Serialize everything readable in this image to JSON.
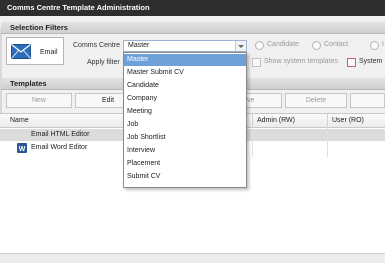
{
  "window": {
    "title": "Comms Centre Template Administration"
  },
  "selection_filters": {
    "header": "Selection Filters",
    "email_button": "Email",
    "comms_centre_label": "Comms Centre",
    "apply_filter_label": "Apply filter",
    "combo_value": "Master",
    "radios": [
      "Candidate",
      "Contact",
      "I"
    ],
    "show_system_templates": "Show system templates",
    "system_label": "System"
  },
  "templates": {
    "header": "Templates",
    "buttons": {
      "new": "New",
      "edit": "Edit",
      "remove_partial": "ve",
      "delete": "Delete"
    },
    "columns": {
      "name": "Name",
      "admin": "Admin (RW)",
      "user": "User (RO)"
    },
    "rows": [
      {
        "name": "Email HTML Editor",
        "selected": true,
        "icon": "none"
      },
      {
        "name": "Email Word Editor",
        "selected": false,
        "icon": "word-icon"
      }
    ]
  },
  "dropdown": {
    "options": [
      "Master",
      "Master Submit CV",
      "Candidate",
      "Company",
      "Meeting",
      "Job",
      "Job Shortlist",
      "Interview",
      "Placement",
      "Submit CV"
    ],
    "highlighted_index": 0,
    "highlight_color": "#6fa0d8"
  }
}
